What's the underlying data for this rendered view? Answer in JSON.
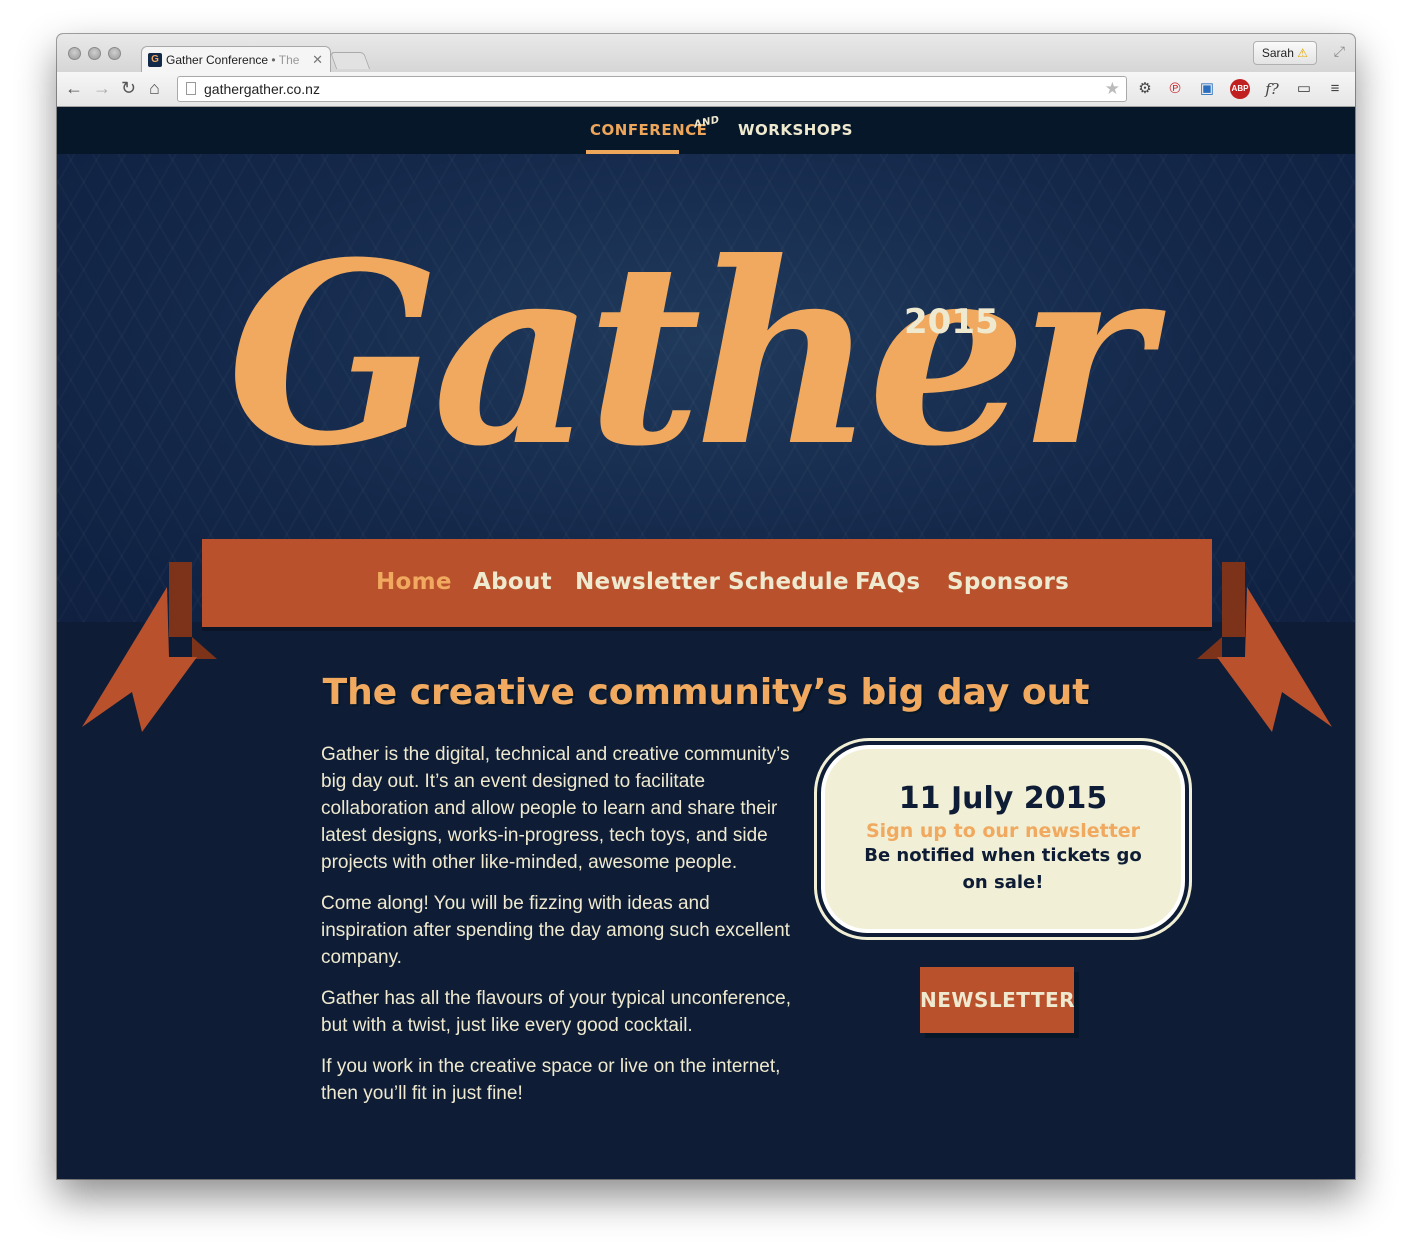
{
  "browser": {
    "tab_title": "Gather Conference",
    "tab_title_extra": "The",
    "profile_name": "Sarah",
    "profile_warning": "⚠",
    "url": "gathergather.co.nz"
  },
  "topnav": {
    "conference": "CONFERENCE",
    "and": "AND",
    "workshops": "WORKSHOPS"
  },
  "hero": {
    "logo_word": "Gather",
    "year": "2015"
  },
  "ribbon": {
    "items": [
      "Home",
      "About",
      "Newsletter",
      "Schedule",
      "FAQs",
      "Sponsors"
    ],
    "active": "Home"
  },
  "tagline": "The creative community’s big day out",
  "paragraphs": [
    "Gather is the digital, technical and creative community’s big day out. It’s an event designed to facilitate collaboration and allow people to learn and share their latest designs, works-in-progress, tech toys, and side projects with other like-minded, awesome people.",
    "Come along! You will be fizzing with ideas and inspiration after spending the day among such excellent company.",
    "Gather has all the flavours of your typical unconference, but with a twist, just like every good cocktail.",
    "If you work in the creative space or live on the internet, then you’ll fit in just fine!"
  ],
  "card": {
    "date": "11 July 2015",
    "cta": "Sign up to our newsletter",
    "sub": "Be notified when tickets go on sale!"
  },
  "newsletter_button": "NEWSLETTER",
  "colors": {
    "navy": "#0e1d35",
    "orange": "#f0a95e",
    "rust": "#b9512d",
    "cream": "#efe9cf"
  }
}
